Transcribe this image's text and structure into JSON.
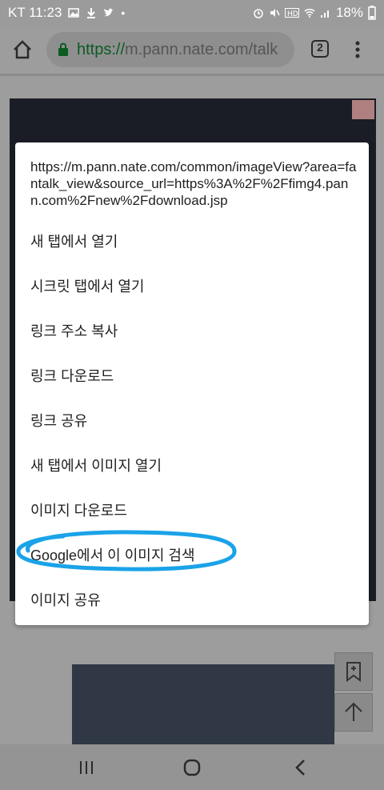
{
  "status_bar": {
    "carrier_time": "KT 11:23",
    "battery": "18%"
  },
  "browser": {
    "url_scheme": "https://",
    "url_rest": "m.pann.nate.com/talk",
    "tab_count": "2"
  },
  "context_menu": {
    "link_url": "https://m.pann.nate.com/common/imageView?area=fantalk_view&source_url=https%3A%2F%2Ffimg4.pann.com%2Fnew%2Fdownload.jsp",
    "items": [
      {
        "label": "새 탭에서 열기"
      },
      {
        "label": "시크릿 탭에서 열기"
      },
      {
        "label": "링크 주소 복사"
      },
      {
        "label": "링크 다운로드"
      },
      {
        "label": "링크 공유"
      },
      {
        "label": "새 탭에서 이미지 열기"
      },
      {
        "label": "이미지 다운로드"
      },
      {
        "label": "Google에서 이 이미지 검색"
      },
      {
        "label": "이미지 공유"
      }
    ],
    "highlight_color": "#1aa3e8"
  }
}
